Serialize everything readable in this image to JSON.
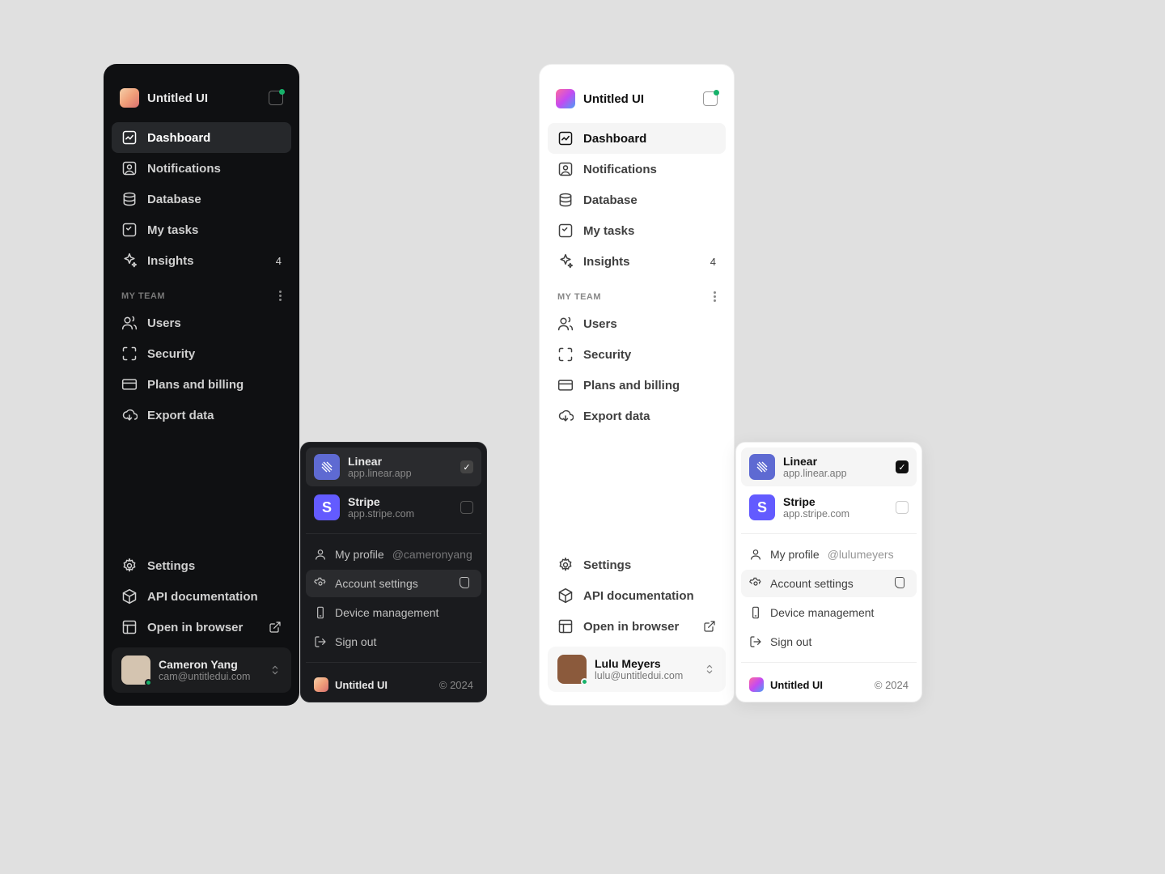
{
  "brand": {
    "name": "Untitled UI"
  },
  "nav": {
    "dashboard": "Dashboard",
    "notifications": "Notifications",
    "database": "Database",
    "mytasks": "My tasks",
    "insights": "Insights",
    "insights_badge": "4"
  },
  "team": {
    "label": "MY TEAM",
    "users": "Users",
    "security": "Security",
    "plans": "Plans and billing",
    "export": "Export data"
  },
  "footer_nav": {
    "settings": "Settings",
    "api": "API documentation",
    "open": "Open in browser"
  },
  "users": {
    "dark": {
      "name": "Cameron Yang",
      "email": "cam@untitledui.com",
      "handle": "@cameronyang"
    },
    "light": {
      "name": "Lulu Meyers",
      "email": "lulu@untitledui.com",
      "handle": "@lulumeyers"
    }
  },
  "popup": {
    "apps": {
      "linear": {
        "name": "Linear",
        "url": "app.linear.app",
        "glyph": "◉"
      },
      "stripe": {
        "name": "Stripe",
        "url": "app.stripe.com",
        "glyph": "S"
      }
    },
    "menu": {
      "profile": "My profile",
      "account": "Account settings",
      "device": "Device management",
      "signout": "Sign out"
    },
    "footer": {
      "brand": "Untitled UI",
      "year": "© 2024"
    }
  }
}
